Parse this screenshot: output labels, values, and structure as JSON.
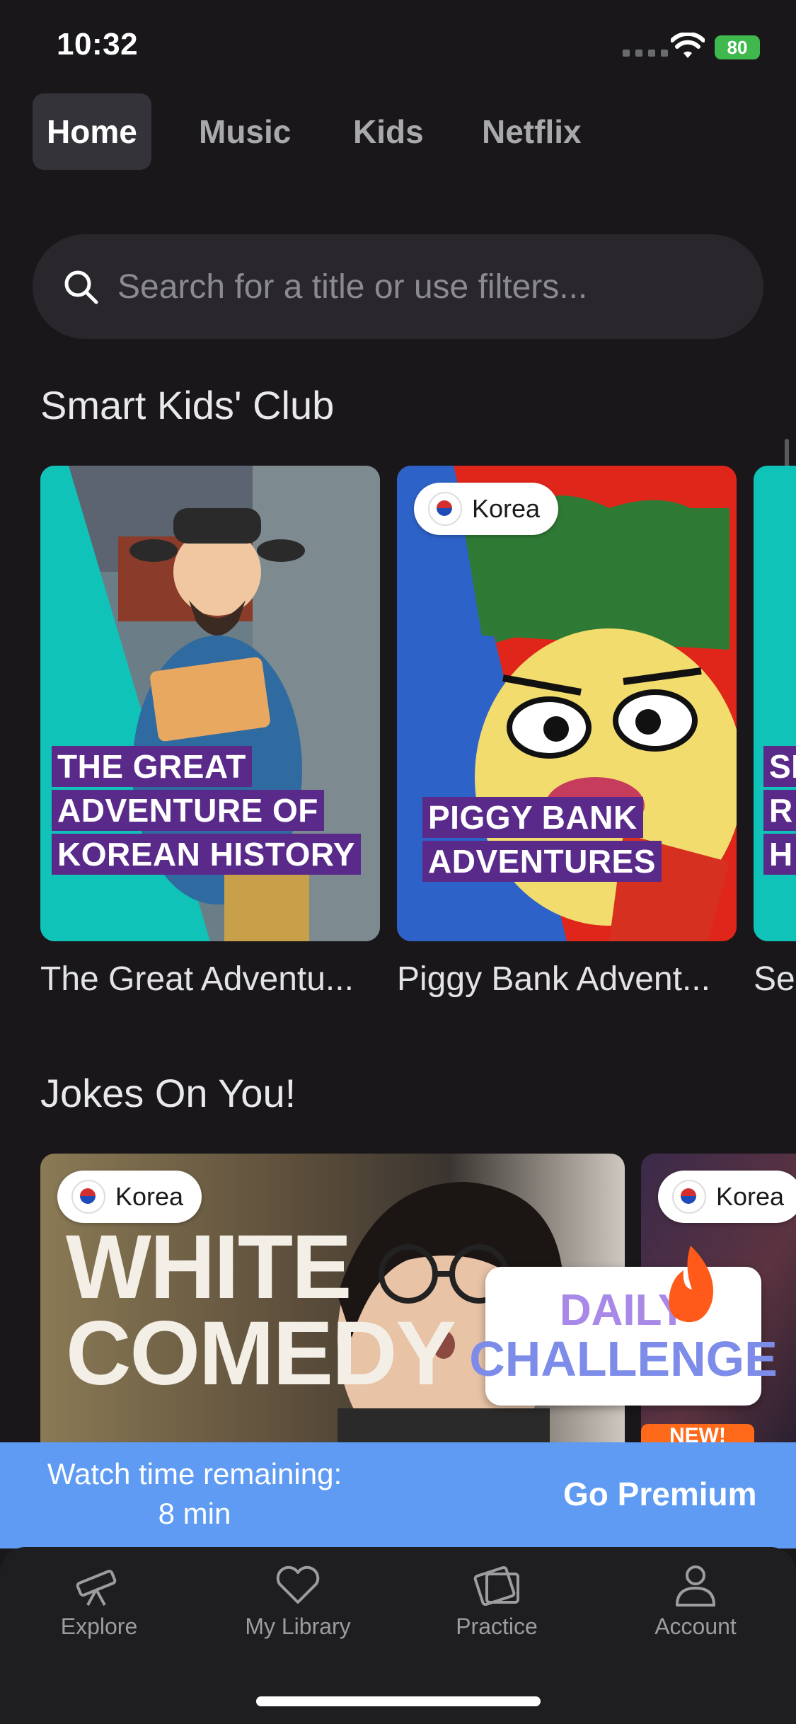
{
  "status": {
    "time": "10:32",
    "battery": "80"
  },
  "tabs": [
    {
      "label": "Home",
      "active": true
    },
    {
      "label": "Music"
    },
    {
      "label": "Kids"
    },
    {
      "label": "Netflix"
    }
  ],
  "search": {
    "placeholder": "Search for a title or use filters..."
  },
  "sections": {
    "kids_club": {
      "title": "Smart Kids' Club",
      "cards": [
        {
          "title": "The Great Adventu...",
          "art_lines": [
            "THE GREAT",
            "ADVENTURE OF",
            "KOREAN HISTORY"
          ]
        },
        {
          "title": "Piggy Bank Advent...",
          "badge": "Korea",
          "art_lines": [
            "PIGGY BANK",
            "ADVENTURES"
          ]
        },
        {
          "title": "Se",
          "art_lines": [
            "SI",
            "R",
            "H"
          ]
        }
      ]
    },
    "jokes": {
      "title": "Jokes On You!",
      "cards": [
        {
          "badge": "Korea",
          "art_lines": [
            "WHITE",
            "COMEDY"
          ]
        },
        {
          "badge": "Korea",
          "art_lines": [
            "DAILY",
            "CHALLENGE"
          ],
          "tag": "NEW!"
        }
      ]
    }
  },
  "premium": {
    "line1": "Watch time remaining:",
    "line2": "8 min",
    "button": "Go Premium"
  },
  "nav": [
    {
      "label": "Explore",
      "icon": "telescope-icon"
    },
    {
      "label": "My Library",
      "icon": "heart-icon"
    },
    {
      "label": "Practice",
      "icon": "cards-icon"
    },
    {
      "label": "Account",
      "icon": "person-icon"
    }
  ],
  "colors": {
    "background": "#19171a",
    "premium_bar": "#5f9bf2",
    "art_label": "#5a2a8a",
    "teal": "#10c3b8"
  }
}
